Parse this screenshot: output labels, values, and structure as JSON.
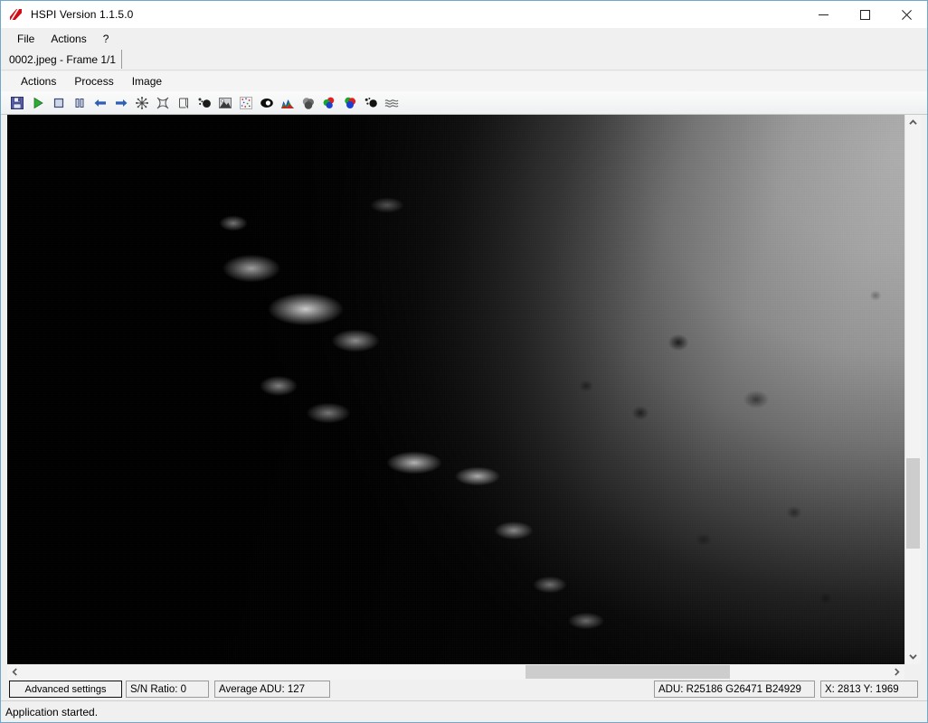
{
  "window": {
    "title": "HSPI Version 1.1.5.0",
    "app_icon": "hspi-logo-icon",
    "controls": {
      "minimize": "minimize-icon",
      "maximize": "maximize-icon",
      "close": "close-icon"
    }
  },
  "menubar": {
    "items": [
      {
        "label": "File"
      },
      {
        "label": "Actions"
      },
      {
        "label": "?"
      }
    ]
  },
  "tabs": [
    {
      "label": "0002.jpeg - Frame 1/1",
      "active": true
    }
  ],
  "innermenu": {
    "items": [
      {
        "label": "Actions"
      },
      {
        "label": "Process"
      },
      {
        "label": "Image"
      }
    ]
  },
  "toolbar": {
    "buttons": [
      {
        "name": "save-icon",
        "title": "Save"
      },
      {
        "name": "play-icon",
        "title": "Start"
      },
      {
        "name": "stop-icon",
        "title": "Stop"
      },
      {
        "name": "pause-icon",
        "title": "Pause"
      },
      {
        "name": "arrow-left-icon",
        "title": "Previous frame"
      },
      {
        "name": "arrow-right-icon",
        "title": "Next frame"
      },
      {
        "name": "snowflake-icon",
        "title": "Dark frame"
      },
      {
        "name": "star-pinch-icon",
        "title": "Flat field"
      },
      {
        "name": "flag-icon",
        "title": "Bias frame"
      },
      {
        "name": "noise-dots-icon",
        "title": "Hot pixel removal"
      },
      {
        "name": "mountain-sky-icon",
        "title": "Gradient removal"
      },
      {
        "name": "speckle-square-icon",
        "title": "Noise reduction"
      },
      {
        "name": "contrast-eye-icon",
        "title": "Contrast"
      },
      {
        "name": "histogram-icon",
        "title": "Histogram"
      },
      {
        "name": "gray-blobs-icon",
        "title": "Levels"
      },
      {
        "name": "rgb-stack-icon",
        "title": "RGB align"
      },
      {
        "name": "rgb-venn-icon",
        "title": "Colour balance"
      },
      {
        "name": "dot-cluster-icon",
        "title": "Star detect"
      },
      {
        "name": "wave-lines-icon",
        "title": "Wavelets"
      }
    ]
  },
  "viewer": {
    "image_name": "0002.jpeg",
    "vscrollbar": {
      "up_arrow": "chevron-up-icon",
      "down_arrow": "chevron-down-icon"
    },
    "hscrollbar": {
      "left_arrow": "chevron-left-icon",
      "right_arrow": "chevron-right-icon"
    }
  },
  "infobar": {
    "advanced_settings_label": "Advanced settings",
    "sn_ratio": "S/N Ratio: 0",
    "average_adu": "Average ADU: 127",
    "adu_rgb": "ADU: R25186 G26471 B24929",
    "coordinates": "X: 2813 Y: 1969"
  },
  "statusbar": {
    "message": "Application started."
  },
  "colors": {
    "window_border": "#6fa8c9",
    "chrome_bg": "#f0f0f0",
    "toolbar_bg": "#f4f5f6",
    "scrollbar_thumb": "#cdcdcd"
  }
}
